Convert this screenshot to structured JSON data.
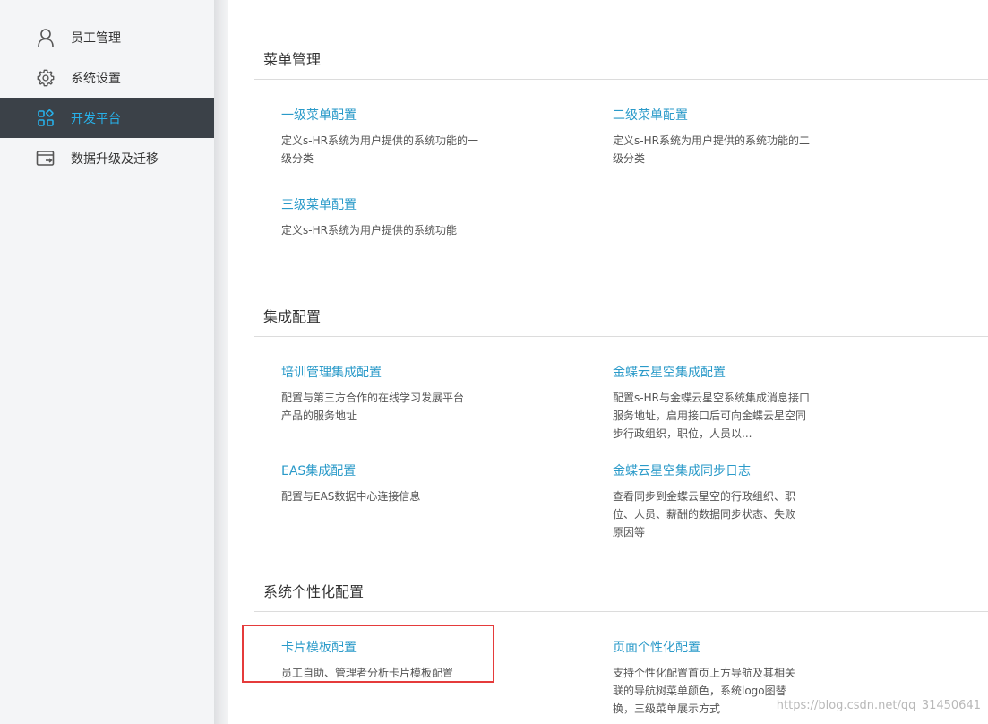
{
  "sidebar": {
    "items": [
      {
        "label": "员工管理",
        "icon": "user-icon",
        "active": false
      },
      {
        "label": "系统设置",
        "icon": "gear-icon",
        "active": false
      },
      {
        "label": "开发平台",
        "icon": "apps-grid-icon",
        "active": true
      },
      {
        "label": "数据升级及迁移",
        "icon": "window-export-icon",
        "active": false
      }
    ]
  },
  "sections": [
    {
      "title": "菜单管理",
      "cards": [
        {
          "title": "一级菜单配置",
          "desc": "定义s-HR系统为用户提供的系统功能的一级分类"
        },
        {
          "title": "二级菜单配置",
          "desc": "定义s-HR系统为用户提供的系统功能的二级分类"
        },
        {
          "title": "三级菜单配置",
          "desc": "定义s-HR系统为用户提供的系统功能"
        }
      ]
    },
    {
      "title": "集成配置",
      "cards": [
        {
          "title": "培训管理集成配置",
          "desc": "配置与第三方合作的在线学习发展平台产品的服务地址"
        },
        {
          "title": "金蝶云星空集成配置",
          "desc": "配置s-HR与金蝶云星空系统集成消息接口服务地址，启用接口后可向金蝶云星空同步行政组织，职位，人员以..."
        },
        {
          "title": "EAS集成配置",
          "desc": "配置与EAS数据中心连接信息"
        },
        {
          "title": "金蝶云星空集成同步日志",
          "desc": "查看同步到金蝶云星空的行政组织、职位、人员、薪酬的数据同步状态、失败原因等"
        }
      ]
    },
    {
      "title": "系统个性化配置",
      "cards": [
        {
          "title": "卡片模板配置",
          "desc": "员工自助、管理者分析卡片模板配置"
        },
        {
          "title": "页面个性化配置",
          "desc": "支持个性化配置首页上方导航及其相关联的导航树菜单颜色，系统logo图替换，三级菜单展示方式"
        }
      ]
    }
  ],
  "watermark": "https://blog.csdn.net/qq_31450641",
  "colors": {
    "accent": "#27b1ea",
    "link": "#2a9ac9",
    "active_bg": "#3b4148",
    "sidebar_bg": "#f4f5f7",
    "highlight": "#e53b3b"
  }
}
